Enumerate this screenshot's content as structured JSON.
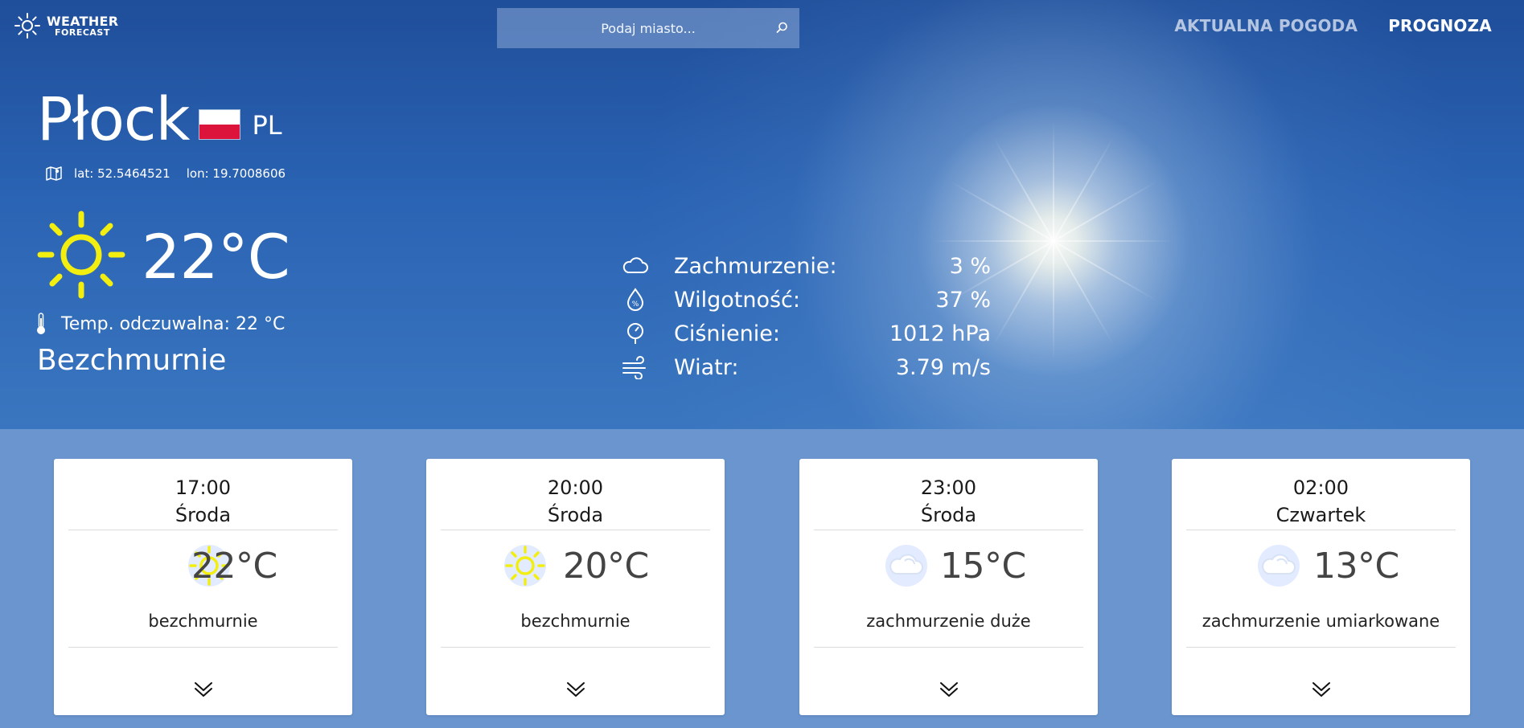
{
  "brand": {
    "line1": "WEATHER",
    "line2": "FORECAST",
    "icon": "sun-icon"
  },
  "search": {
    "placeholder": "Podaj miasto...",
    "icon": "search-icon"
  },
  "nav": {
    "items": [
      {
        "label": "AKTUALNA POGODA"
      },
      {
        "label": "PROGNOZA"
      }
    ]
  },
  "location": {
    "city": "Płock",
    "country": "PL",
    "flag_colors": [
      "#ffffff",
      "#dc143c"
    ],
    "lat_text": "lat: 52.5464521",
    "lon_text": "lon: 19.7008606"
  },
  "current": {
    "icon": "sun-icon",
    "icon_color": "#f2ef10",
    "temperature": "22°C",
    "feels_like": "Temp. odczuwalna: 22 °C",
    "description": "Bezchmurnie"
  },
  "details": [
    {
      "icon": "cloud-icon",
      "label": "Zachmurzenie:",
      "value": "3 %"
    },
    {
      "icon": "humidity-icon",
      "label": "Wilgotność:",
      "value": "37 %"
    },
    {
      "icon": "pressure-icon",
      "label": "Ciśnienie:",
      "value": "1012 hPa"
    },
    {
      "icon": "wind-icon",
      "label": "Wiatr:",
      "value": "3.79 m/s"
    }
  ],
  "forecast": [
    {
      "time": "17:00",
      "day": "Środa",
      "icon": "sun-icon",
      "temperature": "22°C",
      "description": "bezchmurnie"
    },
    {
      "time": "20:00",
      "day": "Środa",
      "icon": "sun-icon",
      "temperature": "20°C",
      "description": "bezchmurnie"
    },
    {
      "time": "23:00",
      "day": "Środa",
      "icon": "cloud-icon",
      "temperature": "15°C",
      "description": "zachmurzenie duże"
    },
    {
      "time": "02:00",
      "day": "Czwartek",
      "icon": "cloud-icon",
      "temperature": "13°C",
      "description": "zachmurzenie umiarkowane"
    }
  ],
  "colors": {
    "accent_sun": "#f2ef10",
    "hero_blue": "#2a63b3",
    "page_blue": "#6a95cf"
  }
}
